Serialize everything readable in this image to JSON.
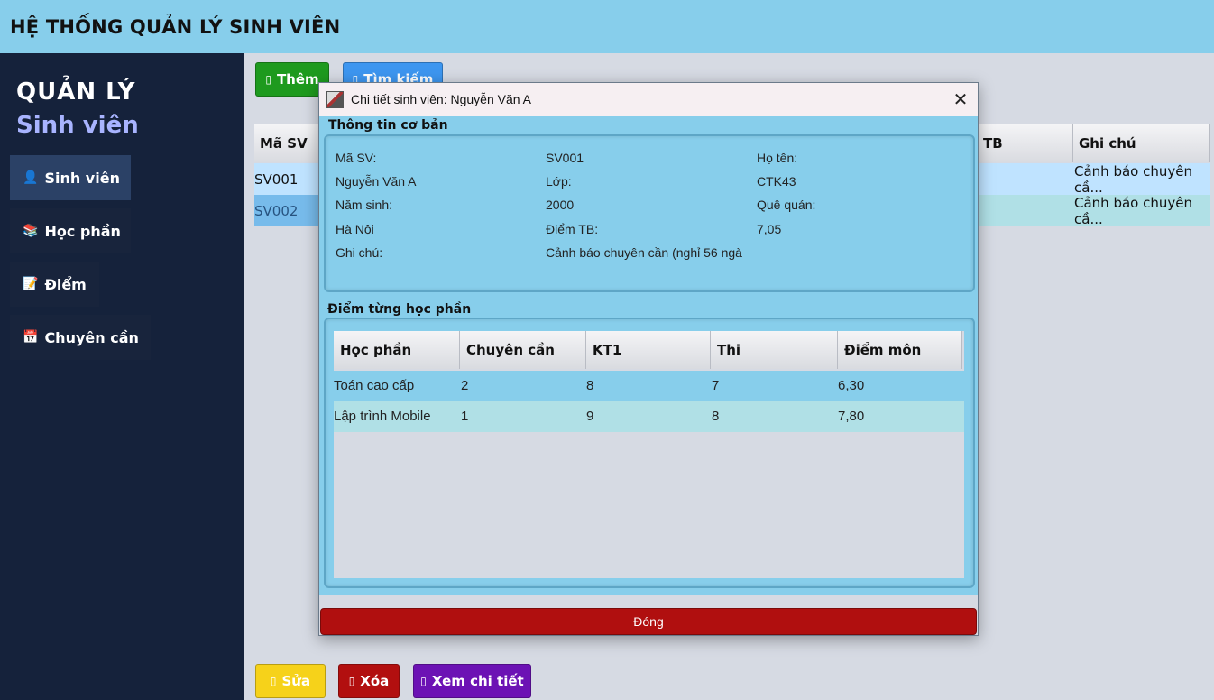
{
  "app": {
    "title": "HỆ THỐNG QUẢN LÝ SINH VIÊN"
  },
  "sidebar": {
    "brand_line1": "QUẢN LÝ",
    "brand_line2": "Sinh viên",
    "items": [
      {
        "icon": "person-icon",
        "glyph": "👤",
        "label": "Sinh viên"
      },
      {
        "icon": "books-icon",
        "glyph": "📚",
        "label": "Học phần"
      },
      {
        "icon": "memo-icon",
        "glyph": "📝",
        "label": "Điểm"
      },
      {
        "icon": "calendar-icon",
        "glyph": "📅",
        "label": "Chuyên cần"
      }
    ]
  },
  "toolbar": {
    "add_icon": "▯",
    "add_label": "Thêm",
    "search_icon": "▯",
    "search_label": "Tìm kiếm",
    "edit_icon": "▯",
    "edit_label": "Sửa",
    "delete_icon": "▯",
    "delete_label": "Xóa",
    "detail_icon": "▯",
    "detail_label": "Xem chi tiết"
  },
  "colors": {
    "header": "#87ceeb",
    "sidebar": "#15223b",
    "add": "#1e9a1e",
    "search": "#3d96f0",
    "edit": "#f6d21a",
    "delete": "#b20f0f",
    "detail": "#6c12b4",
    "close": "#b00f0f"
  },
  "main_table": {
    "headers": {
      "id": "Mã SV",
      "tb": "TB",
      "note": "Ghi chú"
    },
    "rows": [
      {
        "id": "SV001",
        "note": "Cảnh báo chuyên cầ..."
      },
      {
        "id": "SV002",
        "note": "Cảnh báo chuyên cầ..."
      }
    ]
  },
  "dialog": {
    "title": "Chi tiết sinh viên: Nguyễn Văn A",
    "close_glyph": "✕",
    "basic_section": "Thông tin cơ bản",
    "info": [
      "Mã SV:",
      "SV001",
      "Họ tên:",
      "Nguyễn Văn A",
      "Lớp:",
      "CTK43",
      "Năm sinh:",
      "2000",
      "Quê quán:",
      "Hà Nội",
      "Điểm TB:",
      "7,05",
      "Ghi chú:",
      "Cảnh báo chuyên cần (nghỉ 56 ngà"
    ],
    "grades_section": "Điểm từng học phần",
    "grade_headers": [
      "Học phần",
      "Chuyên cần",
      "KT1",
      "Thi",
      "Điểm môn"
    ],
    "grade_rows": [
      [
        "Toán cao cấp",
        "2",
        "8",
        "7",
        "6,30"
      ],
      [
        "Lập trình Mobile",
        "1",
        "9",
        "8",
        "7,80"
      ]
    ],
    "close_button": "Đóng"
  }
}
